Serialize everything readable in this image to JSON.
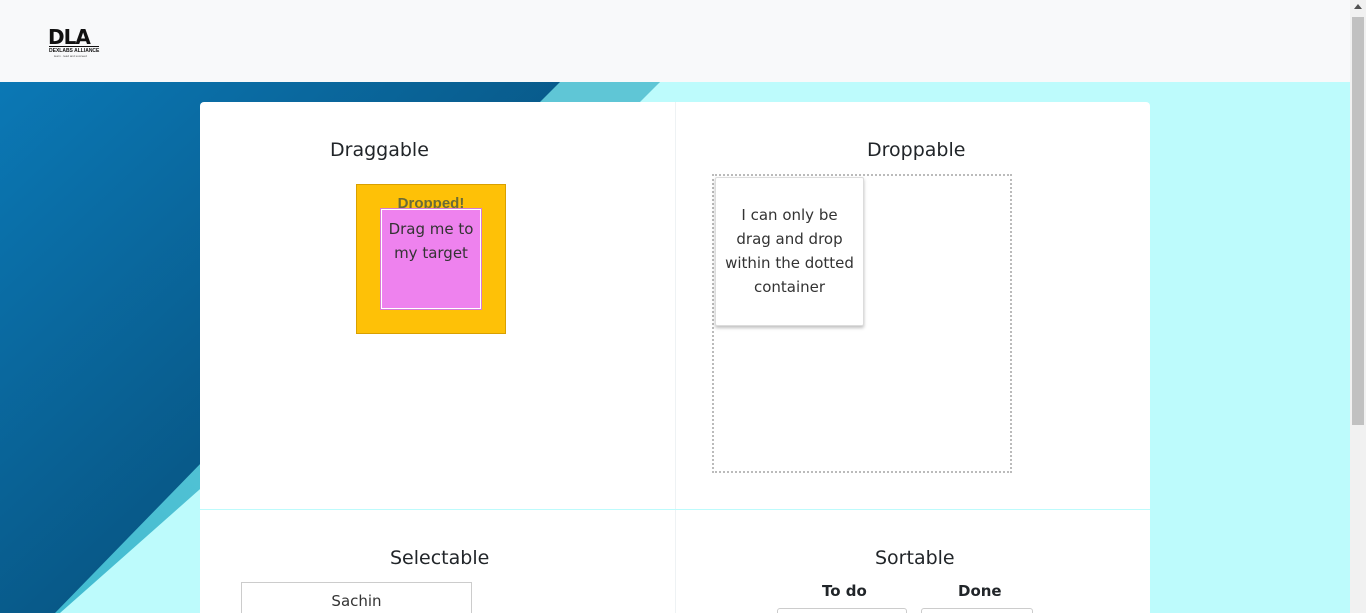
{
  "header": {
    "logo_letters": "DLA",
    "logo_subtitle": "DEXLABS ALLIANCE",
    "logo_tagline": "learn · lead and succeed"
  },
  "draggable": {
    "title": "Draggable",
    "target_text": "Dropped!",
    "drag_box_text": "Drag me to my target"
  },
  "droppable": {
    "title": "Droppable",
    "card_text": "I can only be drag and drop within the dotted container"
  },
  "selectable": {
    "title": "Selectable",
    "items": [
      "Sachin"
    ]
  },
  "sortable": {
    "title": "Sortable",
    "columns": [
      "To do",
      "Done"
    ]
  },
  "colors": {
    "target": "#fec107",
    "drag_box": "#ee82ee",
    "background_light": "#bdfbfc",
    "background_dark": "#0a6a9a"
  }
}
